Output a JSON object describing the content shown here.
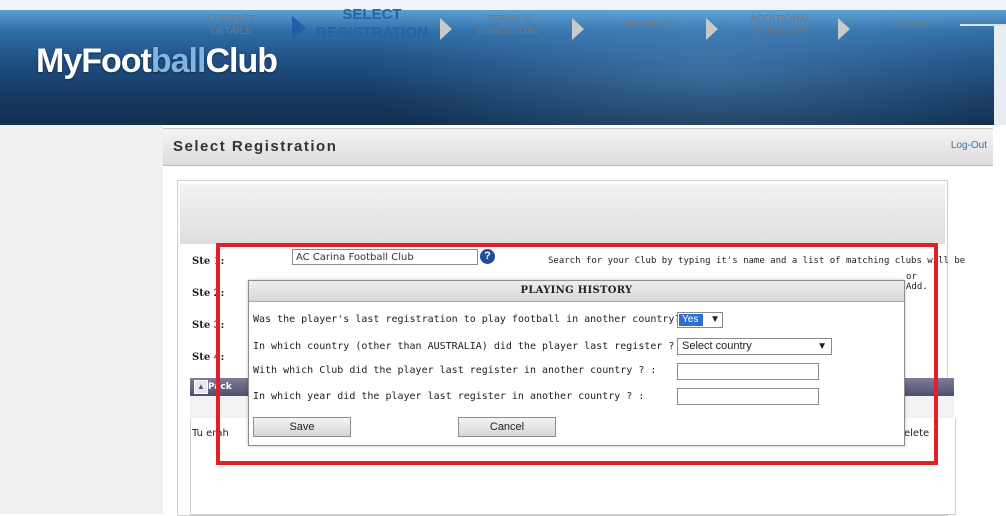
{
  "header": {
    "logo_part1": "MyFoot",
    "logo_part2": "ball",
    "logo_part3": "Club"
  },
  "page": {
    "title": "Select Registration",
    "logout": "Log-Out"
  },
  "steps": [
    {
      "line1": "CONTACT",
      "line2": "DETAILS"
    },
    {
      "line1": "SELECT",
      "line2": "REGISTRATION"
    },
    {
      "line1": "TERMS &",
      "line2": "CONDITIONS"
    },
    {
      "line1": "PAYMENT",
      "line2": ""
    },
    {
      "line1": "ADDITIONAL",
      "line2": "QUESTIONS"
    },
    {
      "line1": "FINISH",
      "line2": ""
    }
  ],
  "form": {
    "step1_label": "Ste 1:",
    "step2_label": "Ste 2:",
    "step3_label": "Ste 3:",
    "step4_label": "Ste 4:",
    "club_value": "AC Carina Football Club",
    "help_glyph": "?",
    "search_hint": "Search for your Club by typing it's name and a list of matching clubs will be",
    "hint_or": "or",
    "hint_add": "Add."
  },
  "packages": {
    "header_label": "Pack",
    "row_text": "Tu erah",
    "delete_label": "elete",
    "collapse_glyph": "▲"
  },
  "modal": {
    "title": "PLAYING HISTORY",
    "q1": "Was the player's last registration to play football in another country? :",
    "q1_value": "Yes",
    "q2": "In which country (other than AUSTRALIA) did the player last register ? :",
    "q2_value": "Select country",
    "q3": "With which Club did the player last register in another country ? :",
    "q4": "In which year did the player last register in another country ? :",
    "save": "Save",
    "cancel": "Cancel"
  },
  "colors": {
    "accent": "#2563a6",
    "highlight_border": "#e3202a"
  }
}
